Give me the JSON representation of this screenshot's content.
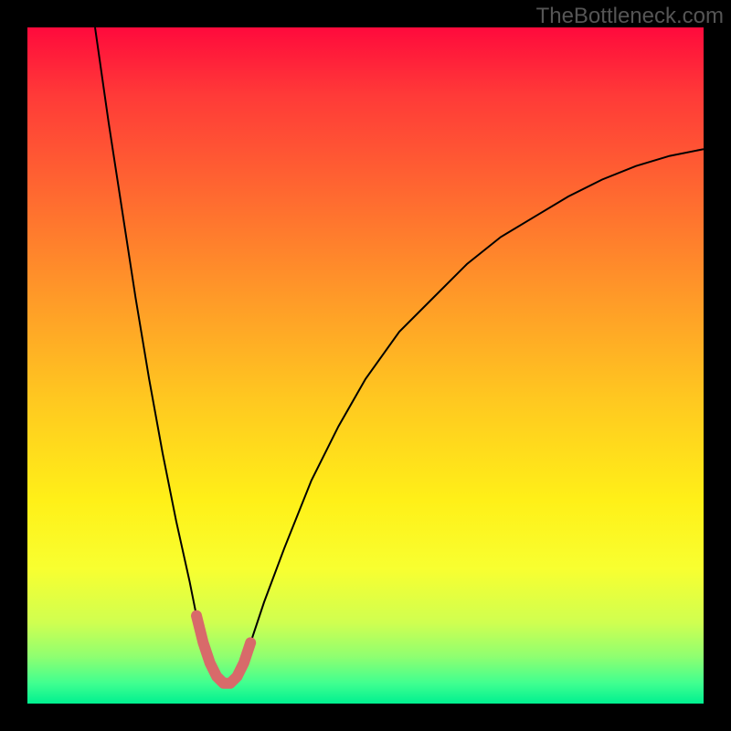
{
  "watermark": "TheBottleneck.com",
  "chart_data": {
    "type": "line",
    "title": "",
    "xlabel": "",
    "ylabel": "",
    "xlim": [
      0,
      100
    ],
    "ylim": [
      0,
      100
    ],
    "background_gradient": {
      "top": "#ff0a3c",
      "bottom": "#00f090"
    },
    "series": [
      {
        "name": "bottleneck-curve",
        "color": "#000000",
        "stroke_width": 2,
        "x": [
          10,
          12,
          14,
          16,
          18,
          20,
          22,
          24,
          25,
          26,
          27,
          28,
          29,
          30,
          31,
          32,
          33,
          35,
          38,
          42,
          46,
          50,
          55,
          60,
          65,
          70,
          75,
          80,
          85,
          90,
          95,
          100
        ],
        "y": [
          100,
          86,
          73,
          60,
          48,
          37,
          27,
          18,
          13,
          9,
          6,
          4,
          3,
          3,
          4,
          6,
          9,
          15,
          23,
          33,
          41,
          48,
          55,
          60,
          65,
          69,
          72,
          75,
          77.5,
          79.5,
          81,
          82
        ]
      },
      {
        "name": "highlight-u",
        "color": "#d86a6a",
        "stroke_width": 12,
        "x": [
          25,
          26,
          27,
          28,
          29,
          30,
          31,
          32,
          33
        ],
        "y": [
          13,
          9,
          6,
          4,
          3,
          3,
          4,
          6,
          9
        ]
      }
    ]
  }
}
